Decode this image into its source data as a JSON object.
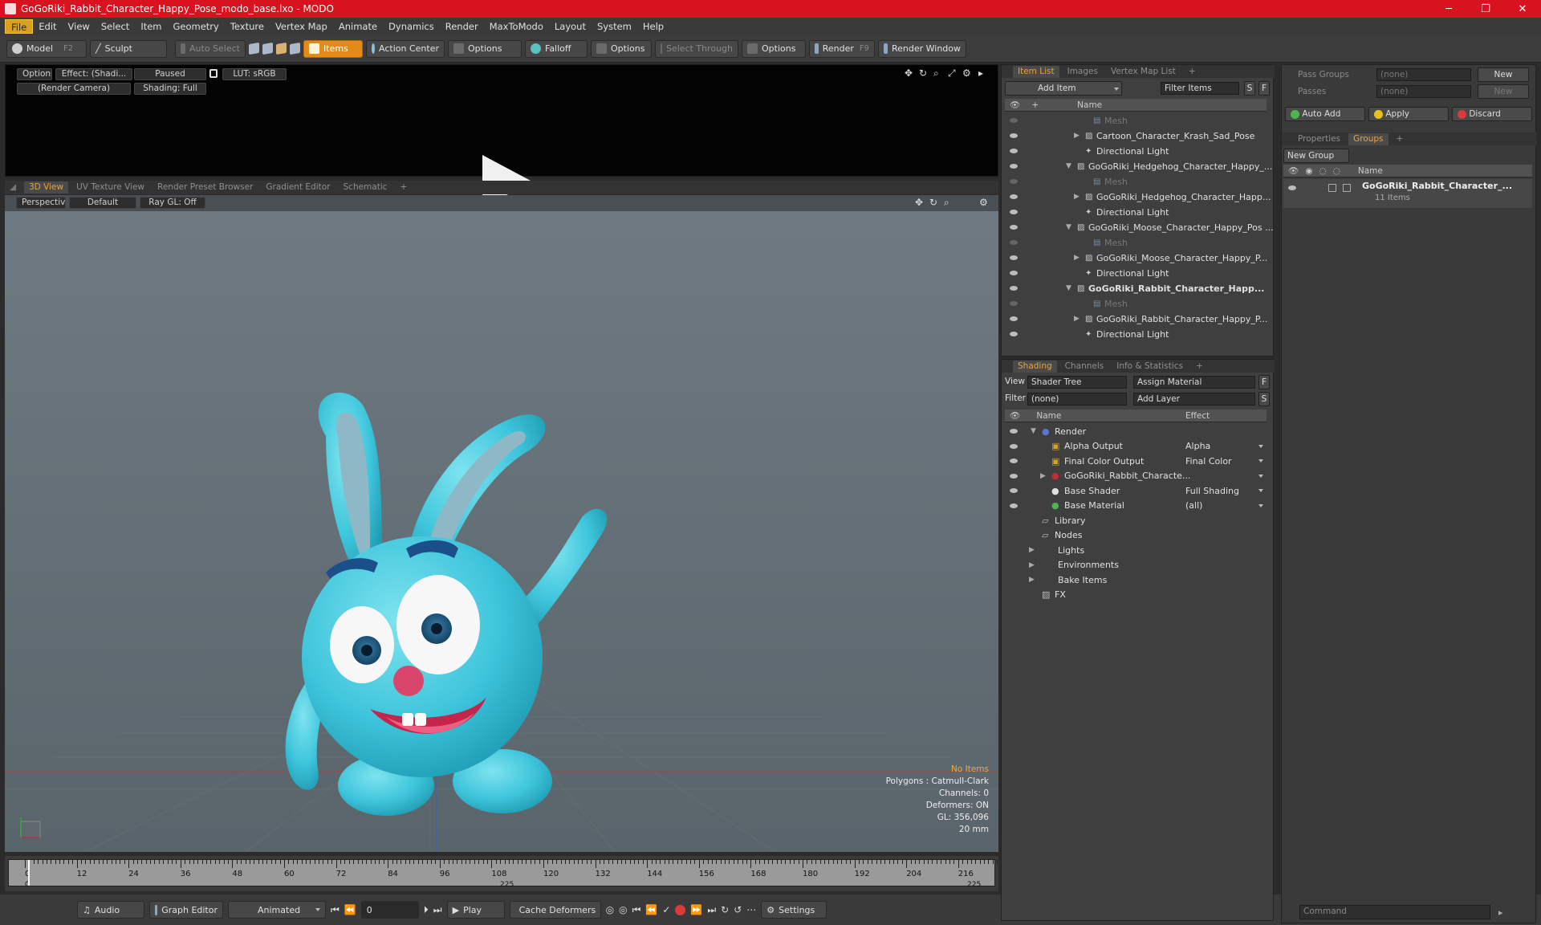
{
  "window": {
    "title": "GoGoRiki_Rabbit_Character_Happy_Pose_modo_base.lxo - MODO",
    "minimize": "─",
    "maximize": "❐",
    "close": "✕"
  },
  "menu": [
    "File",
    "Edit",
    "View",
    "Select",
    "Item",
    "Geometry",
    "Texture",
    "Vertex Map",
    "Animate",
    "Dynamics",
    "Render",
    "MaxToModo",
    "Layout",
    "System",
    "Help"
  ],
  "toolbar": {
    "model": "Model",
    "model_key": "F2",
    "sculpt": "Sculpt",
    "auto_select": "Auto Select",
    "items": "Items",
    "action_center": "Action Center",
    "options1": "Options",
    "falloff": "Falloff",
    "options2": "Options",
    "select_through": "Select Through",
    "options3": "Options",
    "render": "Render",
    "render_key": "F9",
    "render_window": "Render Window"
  },
  "preview": {
    "options": "Options",
    "effect": "Effect: (Shadi...",
    "paused": "Paused",
    "lut": "LUT: sRGB",
    "camera": "(Render Camera)",
    "shading": "Shading: Full"
  },
  "viewport_tabs": [
    "3D View",
    "UV Texture View",
    "Render Preset Browser",
    "Gradient Editor",
    "Schematic",
    "+"
  ],
  "viewport": {
    "perspective": "Perspective",
    "default": "Default",
    "raygl": "Ray GL: Off"
  },
  "stats": {
    "no_items": "No Items",
    "polygons": "Polygons : Catmull-Clark",
    "channels": "Channels: 0",
    "deformers": "Deformers: ON",
    "gl": "GL: 356,096",
    "size": "20 mm"
  },
  "timeline": {
    "ticks": [
      "0",
      "12",
      "24",
      "36",
      "48",
      "60",
      "72",
      "84",
      "96",
      "108",
      "120",
      "132",
      "144",
      "156",
      "168",
      "180",
      "192",
      "204",
      "216"
    ],
    "start": "0",
    "mid": "225",
    "end": "225"
  },
  "transport": {
    "audio": "Audio",
    "graph_editor": "Graph Editor",
    "animated": "Animated",
    "frame": "0",
    "play": "Play",
    "cache": "Cache Deformers",
    "settings": "Settings"
  },
  "item_list": {
    "tabs": [
      "Item List",
      "Images",
      "Vertex Map List",
      "+"
    ],
    "add_item": "Add Item",
    "filter": "Filter Items",
    "s": "S",
    "f": "F",
    "col_name": "Name",
    "rows": [
      {
        "label": "Mesh",
        "indent": 2,
        "dim": true
      },
      {
        "label": "Cartoon_Character_Krash_Sad_Pose",
        "indent": 1,
        "dim": false
      },
      {
        "label": "Directional Light",
        "indent": 1,
        "dim": false
      },
      {
        "label": "GoGoRiki_Hedgehog_Character_Happy_...",
        "indent": 0,
        "dim": false
      },
      {
        "label": "Mesh",
        "indent": 2,
        "dim": true
      },
      {
        "label": "GoGoRiki_Hedgehog_Character_Happ...",
        "indent": 1,
        "dim": false
      },
      {
        "label": "Directional Light",
        "indent": 1,
        "dim": false
      },
      {
        "label": "GoGoRiki_Moose_Character_Happy_Pos ...",
        "indent": 0,
        "dim": false
      },
      {
        "label": "Mesh",
        "indent": 2,
        "dim": true
      },
      {
        "label": "GoGoRiki_Moose_Character_Happy_P...",
        "indent": 1,
        "dim": false
      },
      {
        "label": "Directional Light",
        "indent": 1,
        "dim": false
      },
      {
        "label": "GoGoRiki_Rabbit_Character_Happ...",
        "indent": 0,
        "dim": false,
        "bold": true
      },
      {
        "label": "Mesh",
        "indent": 2,
        "dim": true
      },
      {
        "label": "GoGoRiki_Rabbit_Character_Happy_P...",
        "indent": 1,
        "dim": false
      },
      {
        "label": "Directional Light",
        "indent": 1,
        "dim": false
      }
    ]
  },
  "shading": {
    "tabs": [
      "Shading",
      "Channels",
      "Info & Statistics",
      "+"
    ],
    "view_label": "View",
    "view_value": "Shader Tree",
    "assign": "Assign Material",
    "f": "F",
    "filter_label": "Filter",
    "filter_value": "(none)",
    "add_layer": "Add Layer",
    "s": "S",
    "col_name": "Name",
    "col_effect": "Effect",
    "rows": [
      {
        "label": "Render",
        "effect": "",
        "indent": 0
      },
      {
        "label": "Alpha Output",
        "effect": "Alpha",
        "indent": 1
      },
      {
        "label": "Final Color Output",
        "effect": "Final Color",
        "indent": 1
      },
      {
        "label": "GoGoRiki_Rabbit_Characte...",
        "effect": "",
        "indent": 1
      },
      {
        "label": "Base Shader",
        "effect": "Full Shading",
        "indent": 1
      },
      {
        "label": "Base Material",
        "effect": "(all)",
        "indent": 1
      },
      {
        "label": "Library",
        "effect": "",
        "indent": 0
      },
      {
        "label": "Nodes",
        "effect": "",
        "indent": 0
      },
      {
        "label": "Lights",
        "effect": "",
        "indent": -1
      },
      {
        "label": "Environments",
        "effect": "",
        "indent": -1
      },
      {
        "label": "Bake Items",
        "effect": "",
        "indent": -1
      },
      {
        "label": "FX",
        "effect": "",
        "indent": 0
      }
    ]
  },
  "groups_panel": {
    "pass_groups": "Pass Groups",
    "passes": "Passes",
    "none": "(none)",
    "new": "New",
    "auto_add": "Auto Add",
    "apply": "Apply",
    "discard": "Discard",
    "tabs": [
      "Properties",
      "Groups",
      "+"
    ],
    "new_group": "New Group",
    "col_name": "Name",
    "group_name": "GoGoRiki_Rabbit_Character_...",
    "group_count": "11 Items"
  },
  "command": {
    "placeholder": "Command"
  }
}
